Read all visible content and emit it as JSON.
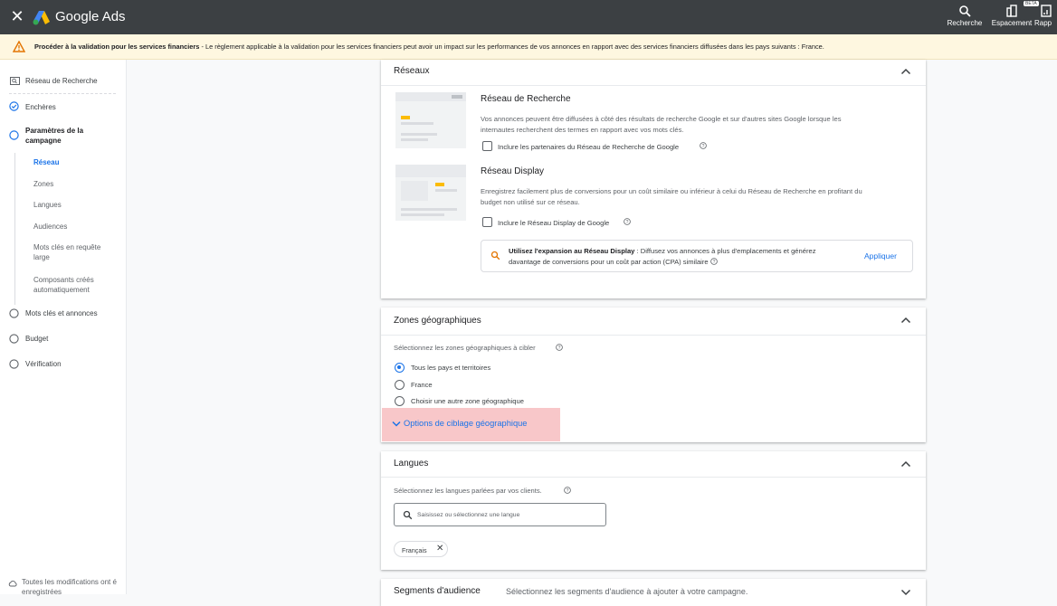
{
  "app": {
    "title": "Google Ads"
  },
  "top_actions": [
    {
      "label": "Recherche",
      "icon": "search-icon"
    },
    {
      "label": "Espacement",
      "icon": "spacing-icon"
    },
    {
      "label": "Rapp",
      "icon": "reports-icon"
    }
  ],
  "top_badge": "BÊTA",
  "banner": {
    "bold": "Procéder à la validation pour les services financiers",
    "text": " - Le règlement applicable à la validation pour les services financiers peut avoir un impact sur les performances de vos annonces en rapport avec des services financiers diffusées dans les pays suivants : France."
  },
  "sidebar": {
    "items": [
      {
        "label": "Réseau de Recherche",
        "icon": "search-network-icon"
      },
      {
        "label": "Enchères",
        "icon": "check-circle-icon"
      },
      {
        "label": "Paramètres de la",
        "label2": "campagne",
        "icon": "circle-icon"
      },
      {
        "label": "Mots clés et annonces",
        "icon": "circle-icon"
      },
      {
        "label": "Budget",
        "icon": "circle-icon"
      },
      {
        "label": "Vérification",
        "icon": "circle-icon"
      }
    ],
    "sub_items": [
      {
        "label": "Réseau"
      },
      {
        "label": "Zones"
      },
      {
        "label": "Langues"
      },
      {
        "label": "Audiences"
      },
      {
        "label": "Mots clés en requête",
        "label2": "large"
      },
      {
        "label": "Composants créés",
        "label2": "automatiquement"
      }
    ],
    "save_status_1": "Toutes les modifications ont é",
    "save_status_2": "enregistrées"
  },
  "networks": {
    "title": "Réseaux",
    "search": {
      "title": "Réseau de Recherche",
      "desc1": "Vos annonces peuvent être diffusées à côté des résultats de recherche Google et sur d'autres sites Google lorsque les",
      "desc2": "internautes recherchent des termes en rapport avec vos mots clés.",
      "checkbox": "Inclure les partenaires du Réseau de Recherche de Google",
      "checked": false
    },
    "display": {
      "title": "Réseau Display",
      "desc1": "Enregistrez facilement plus de conversions pour un coût similaire ou inférieur à celui du Réseau de Recherche en profitant du",
      "desc2": "budget non utilisé sur ce réseau.",
      "checkbox": "Inclure le Réseau Display de Google",
      "checked": false
    },
    "expansion": {
      "bold": "Utilisez l'expansion au Réseau Display",
      "text1": " : Diffusez vos annonces à plus d'emplacements et générez",
      "text2": "davantage de conversions pour un coût par action (CPA) similaire",
      "apply": "Appliquer"
    }
  },
  "geo": {
    "title": "Zones géographiques",
    "select_label": "Sélectionnez les zones géographiques à cibler",
    "options": [
      {
        "label": "Tous les pays et territoires",
        "selected": true
      },
      {
        "label": "France",
        "selected": false
      },
      {
        "label": "Choisir une autre zone géographique",
        "selected": false
      }
    ],
    "targeting_options": "Options de ciblage géographique"
  },
  "languages": {
    "title": "Langues",
    "select_label": "Sélectionnez les langues parlées par vos clients.",
    "placeholder": "Saisissez ou sélectionnez une langue",
    "chips": [
      "Français"
    ]
  },
  "audience": {
    "title": "Segments d'audience",
    "desc": "Sélectionnez les segments d'audience à ajouter à votre campagne."
  },
  "colors": {
    "accent": "#1a73e8",
    "topbar": "#3c4043",
    "warning_bg": "#fef7e0",
    "highlight": "#f8c7c9",
    "thumb_yellow": "#fbbc04"
  }
}
